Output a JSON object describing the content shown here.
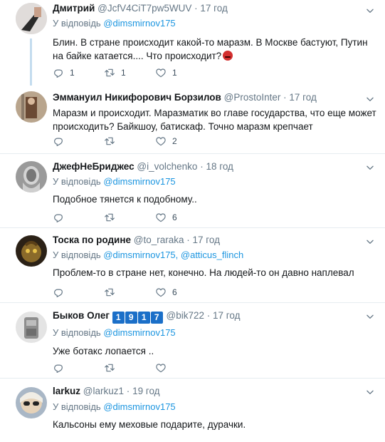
{
  "tweets": [
    {
      "name": "Дмитрий",
      "handle": "@JcfV4CiT7pw5WUV",
      "time": "17 год",
      "reply_prefix": "У відповідь",
      "reply_mentions": [
        "@dimsmirnov175"
      ],
      "text": "Блин. В стране происходит какой-то маразм. В Москве бастуют, Путин на байке катается.... Что происходит?",
      "emoji": "angry-face-emoji",
      "counts": {
        "reply": "1",
        "retweet": "1",
        "like": "1"
      }
    },
    {
      "name": "Эммануил Никифорович Борзилов",
      "handle": "@ProstoInter",
      "time": "17 год",
      "text": "Маразм и происходит. Маразматик во главе государства, что еще может происходить? Байкшоу, батискаф. Точно маразм крепчает",
      "counts": {
        "reply": "",
        "retweet": "",
        "like": "2"
      }
    },
    {
      "name": "ДжефНеБриджес",
      "handle": "@i_volchenko",
      "time": "18 год",
      "reply_prefix": "У відповідь",
      "reply_mentions": [
        "@dimsmirnov175"
      ],
      "text": "Подобное тянется к подобному..",
      "counts": {
        "reply": "",
        "retweet": "",
        "like": "6"
      }
    },
    {
      "name": "Тоска по родине",
      "handle": "@to_raraka",
      "time": "17 год",
      "reply_prefix": "У відповідь",
      "reply_mentions": [
        "@dimsmirnov175,",
        "@atticus_flinch"
      ],
      "text": "Проблем-то в стране нет, конечно. На людей-то он давно наплевал",
      "counts": {
        "reply": "",
        "retweet": "",
        "like": "6"
      }
    },
    {
      "name": "Быков Олег",
      "name_badges": [
        "1",
        "9",
        "1",
        "7"
      ],
      "handle": "@bik722",
      "time": "17 год",
      "reply_prefix": "У відповідь",
      "reply_mentions": [
        "@dimsmirnov175"
      ],
      "text": "Уже ботакс лопается ..",
      "counts": {
        "reply": "",
        "retweet": "",
        "like": ""
      }
    },
    {
      "name": "larkuz",
      "handle": "@larkuz1",
      "time": "19 год",
      "reply_prefix": "У відповідь",
      "reply_mentions": [
        "@dimsmirnov175"
      ],
      "text": "Кальсоны ему меховые подарите, дурачки.",
      "counts": {
        "reply": "",
        "retweet": "",
        "like": ""
      }
    }
  ],
  "separator": "·",
  "icons": {
    "reply": "reply-icon",
    "retweet": "retweet-icon",
    "like": "heart-icon",
    "menu": "chevron-down-icon"
  },
  "colors": {
    "link": "#1b95e0",
    "muted": "#657786",
    "thread_line": "#c4dcef",
    "badge": "#1b6fc8"
  }
}
